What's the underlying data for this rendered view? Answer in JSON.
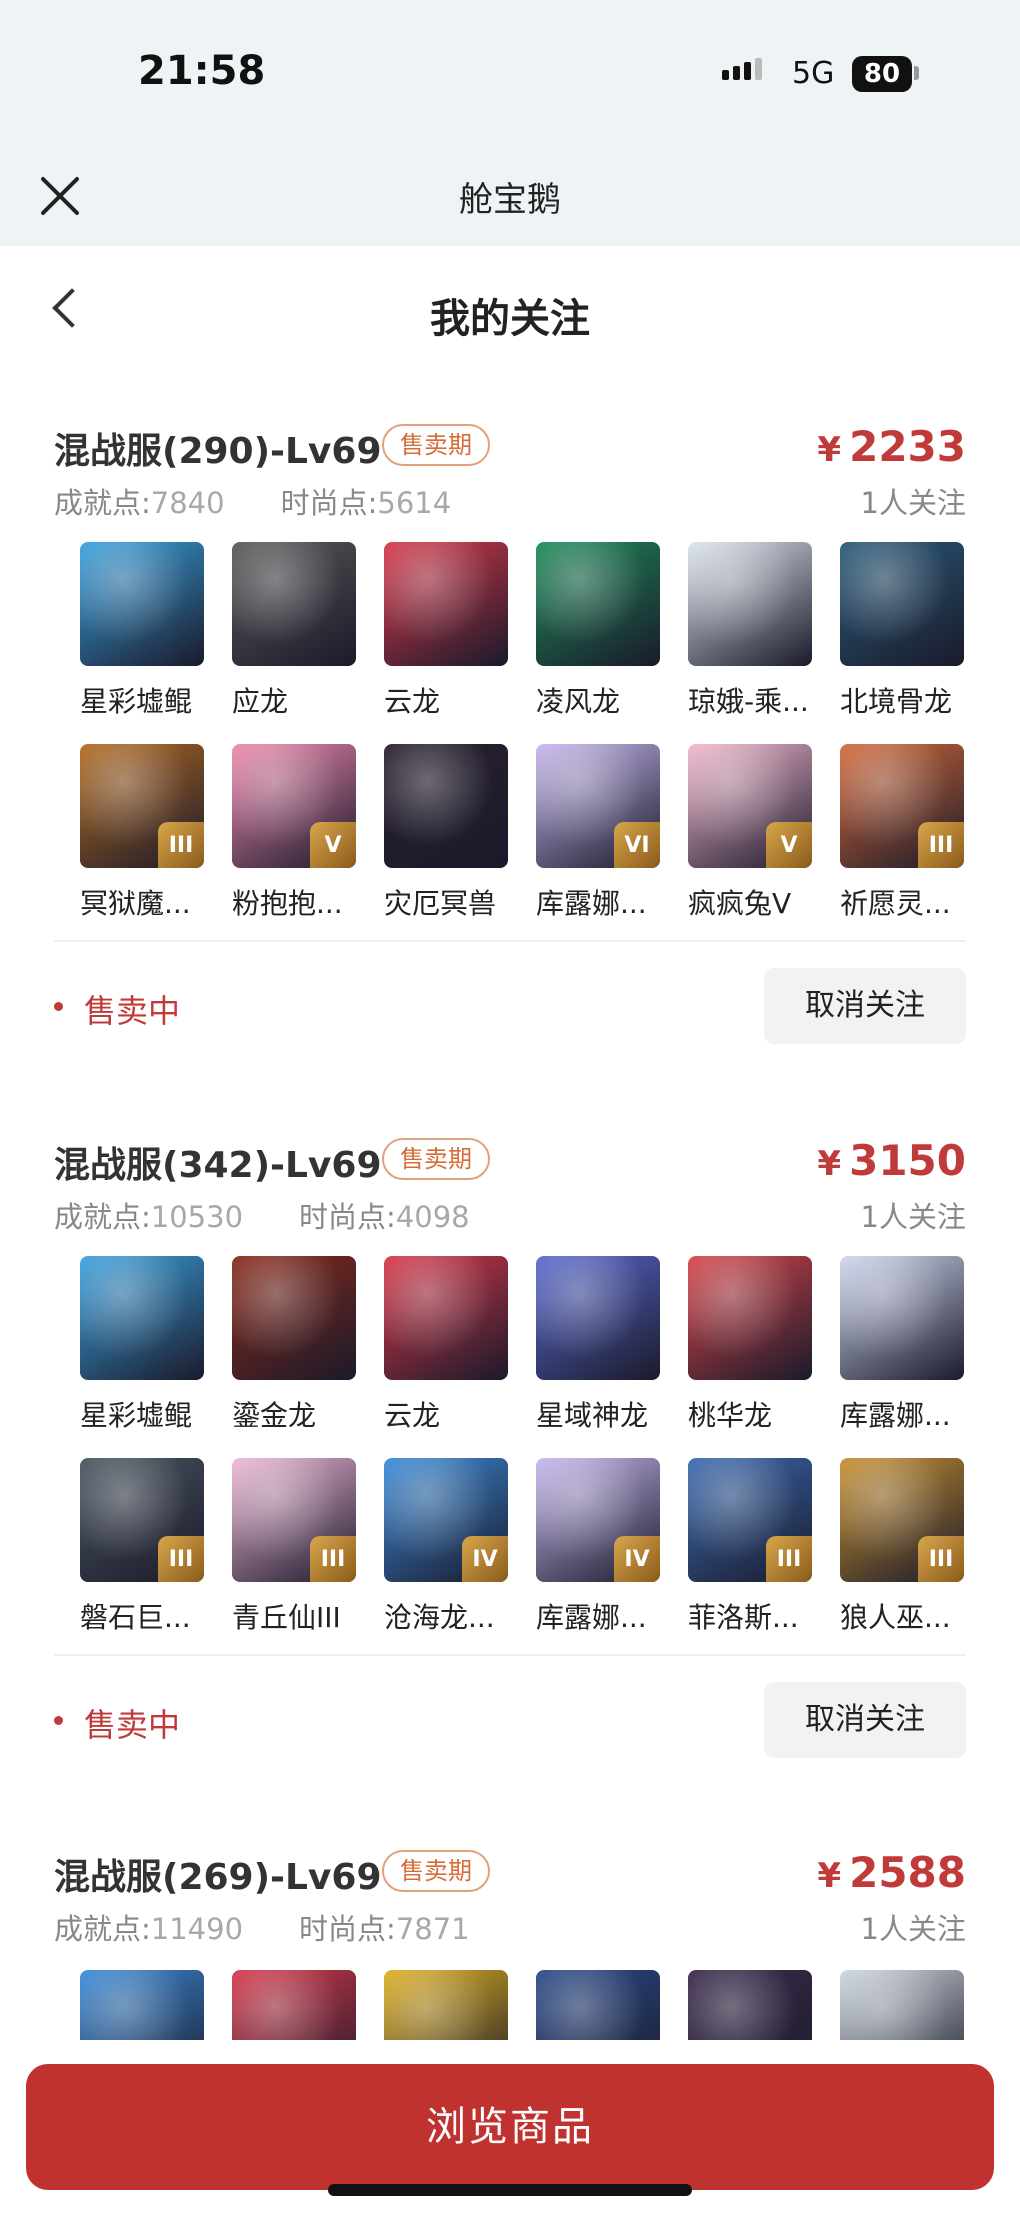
{
  "status": {
    "time": "21:58",
    "network": "5G",
    "battery": "80"
  },
  "app": {
    "title": "舱宝鹅"
  },
  "page": {
    "title": "我的关注"
  },
  "cards": [
    {
      "server": "混战服(290)-Lv69",
      "badge": "售卖期",
      "price": "2233",
      "currency": "¥",
      "achievement_label": "成就点:",
      "achievement": "7840",
      "fashion_label": "时尚点:",
      "fashion": "5614",
      "followers": "1人关注",
      "items": [
        {
          "name": "星彩墟鲲",
          "color": "#3aa2e0",
          "roman": ""
        },
        {
          "name": "应龙",
          "color": "#5a5a5a",
          "roman": ""
        },
        {
          "name": "云龙",
          "color": "#d8384a",
          "roman": ""
        },
        {
          "name": "凌风龙",
          "color": "#1e8a5a",
          "roman": ""
        },
        {
          "name": "琼娥-乘...",
          "color": "#dfe6f0",
          "roman": ""
        },
        {
          "name": "北境骨龙",
          "color": "#2a5a7a",
          "roman": ""
        },
        {
          "name": "冥狱魔...",
          "color": "#b36a22",
          "roman": "III"
        },
        {
          "name": "粉抱抱...",
          "color": "#f08ab0",
          "roman": "V"
        },
        {
          "name": "灾厄冥兽",
          "color": "#2a2030",
          "roman": ""
        },
        {
          "name": "库露娜...",
          "color": "#c8b8f0",
          "roman": "VI"
        },
        {
          "name": "疯疯兔V",
          "color": "#f5b8d0",
          "roman": "V"
        },
        {
          "name": "祈愿灵...",
          "color": "#d46a3a",
          "roman": "III"
        }
      ],
      "sale_status": "售卖中",
      "unfollow": "取消关注"
    },
    {
      "server": "混战服(342)-Lv69",
      "badge": "售卖期",
      "price": "3150",
      "currency": "¥",
      "achievement_label": "成就点:",
      "achievement": "10530",
      "fashion_label": "时尚点:",
      "fashion": "4098",
      "followers": "1人关注",
      "items": [
        {
          "name": "星彩墟鲲",
          "color": "#3aa2e0",
          "roman": ""
        },
        {
          "name": "鎏金龙",
          "color": "#8a2a1a",
          "roman": ""
        },
        {
          "name": "云龙",
          "color": "#d8384a",
          "roman": ""
        },
        {
          "name": "星域神龙",
          "color": "#5a6ad0",
          "roman": ""
        },
        {
          "name": "桃华龙",
          "color": "#d8454a",
          "roman": ""
        },
        {
          "name": "库露娜...",
          "color": "#d0d8f0",
          "roman": ""
        },
        {
          "name": "磐石巨...",
          "color": "#4a5560",
          "roman": "III"
        },
        {
          "name": "青丘仙III",
          "color": "#f0b8d8",
          "roman": "III"
        },
        {
          "name": "沧海龙...",
          "color": "#3a8ad8",
          "roman": "IV"
        },
        {
          "name": "库露娜...",
          "color": "#c8b8f0",
          "roman": "IV"
        },
        {
          "name": "菲洛斯...",
          "color": "#3a6ab0",
          "roman": "III"
        },
        {
          "name": "狼人巫...",
          "color": "#c89030",
          "roman": "III"
        }
      ],
      "sale_status": "售卖中",
      "unfollow": "取消关注"
    },
    {
      "server": "混战服(269)-Lv69",
      "badge": "售卖期",
      "price": "2588",
      "currency": "¥",
      "achievement_label": "成就点:",
      "achievement": "11490",
      "fashion_label": "时尚点:",
      "fashion": "7871",
      "followers": "1人关注",
      "items": [
        {
          "name": "",
          "color": "#3a8ad8",
          "roman": ""
        },
        {
          "name": "",
          "color": "#d8384a",
          "roman": ""
        },
        {
          "name": "",
          "color": "#e0b020",
          "roman": ""
        },
        {
          "name": "",
          "color": "#2a4a8a",
          "roman": ""
        },
        {
          "name": "",
          "color": "#3a2a4a",
          "roman": ""
        },
        {
          "name": "",
          "color": "#cfd8e0",
          "roman": ""
        }
      ]
    }
  ],
  "footer": {
    "browse": "浏览商品"
  }
}
